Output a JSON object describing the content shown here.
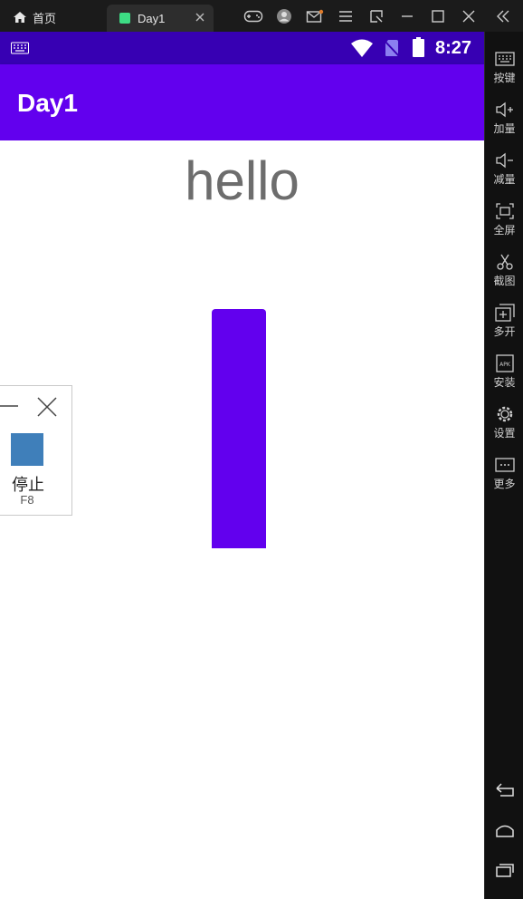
{
  "titlebar": {
    "home_tab": "首页",
    "app_tab": "Day1"
  },
  "statusbar": {
    "time": "8:27"
  },
  "appbar": {
    "title": "Day1"
  },
  "content": {
    "hello_text": "hello"
  },
  "stop_panel": {
    "label": "停止",
    "shortcut": "F8"
  },
  "sidebar": {
    "items": [
      {
        "label": "按键",
        "icon": "keyboard-icon"
      },
      {
        "label": "加量",
        "icon": "volume-up-icon"
      },
      {
        "label": "减量",
        "icon": "volume-down-icon"
      },
      {
        "label": "全屏",
        "icon": "fullscreen-icon"
      },
      {
        "label": "截图",
        "icon": "scissors-icon"
      },
      {
        "label": "多开",
        "icon": "multi-instance-icon"
      },
      {
        "label": "安装",
        "icon": "apk-install-icon"
      },
      {
        "label": "设置",
        "icon": "gear-icon"
      },
      {
        "label": "更多",
        "icon": "more-icon"
      }
    ]
  },
  "colors": {
    "primary": "#6200ee",
    "primary_dark": "#3700b3",
    "stop_square": "#3f7fba"
  }
}
